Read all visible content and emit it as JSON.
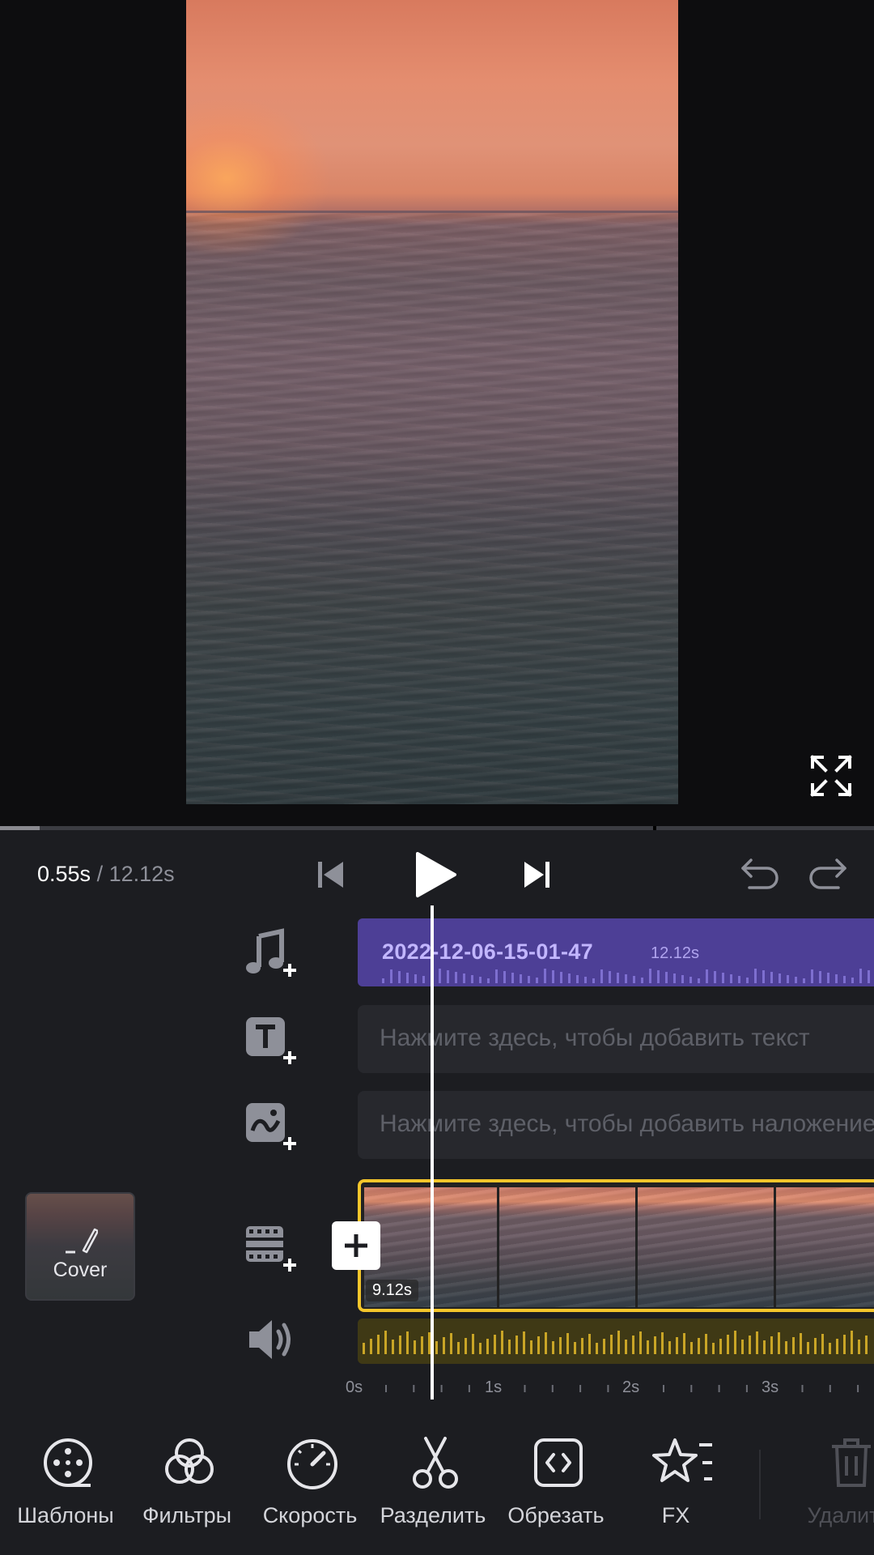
{
  "player": {
    "current_time": "0.55s",
    "separator": " / ",
    "total_time": "12.12s",
    "progress_fraction": 0.045
  },
  "tracks": {
    "audio": {
      "name": "2022-12-06-15-01-47",
      "duration": "12.12s"
    },
    "text": {
      "placeholder": "Нажмите здесь, чтобы добавить текст"
    },
    "overlay": {
      "placeholder": "Нажмите здесь, чтобы добавить наложение"
    },
    "video": {
      "clip_duration": "9.12s"
    }
  },
  "cover": {
    "label": "Cover"
  },
  "ruler": {
    "labels": [
      "0s",
      "1s",
      "2s",
      "3s"
    ]
  },
  "toolbar": {
    "templates": "Шаблоны",
    "filters": "Фильтры",
    "speed": "Скорость",
    "split": "Разделить",
    "trim": "Обрезать",
    "fx": "FX",
    "delete": "Удалить"
  },
  "colors": {
    "accent_yellow": "#f5c62b",
    "audio_purple": "#4d3f96",
    "audio_text": "#c2b6ff"
  },
  "icons": {
    "fullscreen": "fullscreen-icon",
    "skip_start": "skip-start-icon",
    "play": "play-icon",
    "skip_end": "skip-end-icon",
    "undo": "undo-icon",
    "redo": "redo-icon"
  }
}
